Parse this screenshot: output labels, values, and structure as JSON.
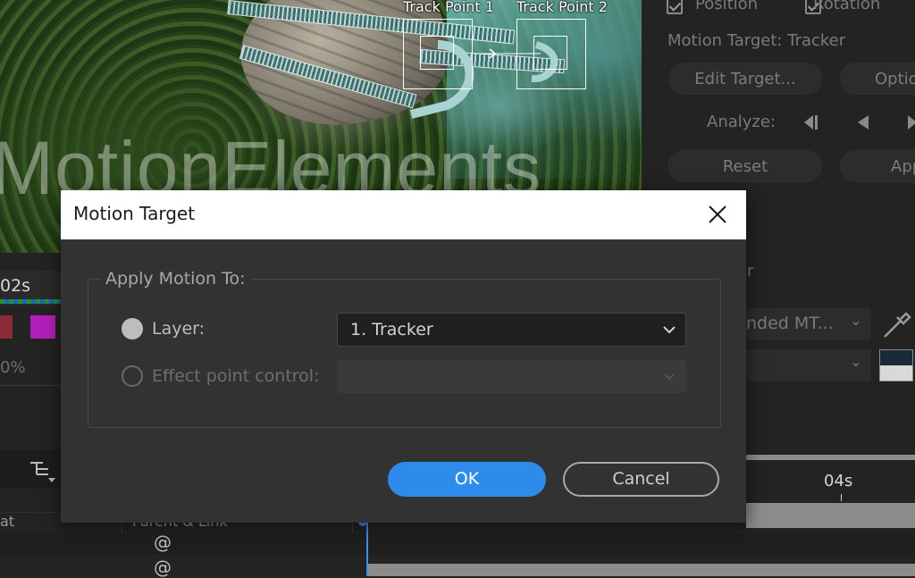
{
  "preview": {
    "track_point_1": "Track Point 1",
    "track_point_2": "Track Point 2",
    "watermark": "MotionElements"
  },
  "tracker_panel": {
    "position_label": "Position",
    "rotation_label": "Rotation",
    "motion_target": "Motion Target: Tracker",
    "edit_target": "Edit Target...",
    "options": "Options",
    "analyze_label": "Analyze:",
    "reset": "Reset",
    "apply": "Apply"
  },
  "background": {
    "time_left": "02s",
    "zoom_value": "0%",
    "blend_dropdown": "nded MT...",
    "time_right": "04s",
    "col_left": "at",
    "col_parent": "Parent & Link"
  },
  "dialog": {
    "title": "Motion Target",
    "group_legend": "Apply Motion To:",
    "layer_label": "Layer:",
    "layer_value": "1. Tracker",
    "effect_label": "Effect point control:",
    "effect_value": "",
    "ok_label": "OK",
    "cancel_label": "Cancel"
  },
  "colors": {
    "accent": "#2d8ceb",
    "dialog_bg": "#323232",
    "titlebar_bg": "#ffffff"
  }
}
